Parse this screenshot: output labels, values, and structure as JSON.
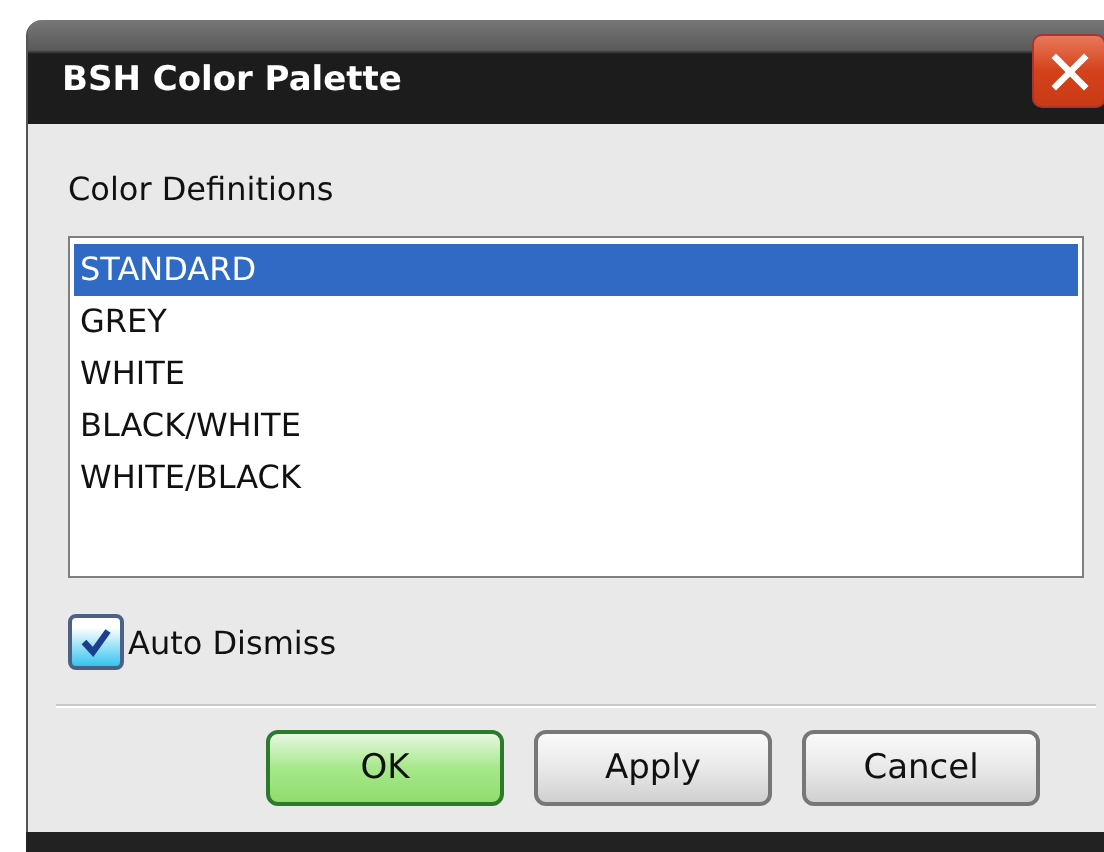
{
  "window": {
    "title": "BSH Color Palette"
  },
  "list_label": "Color Definitions",
  "color_definitions": [
    {
      "label": "STANDARD",
      "selected": true
    },
    {
      "label": "GREY",
      "selected": false
    },
    {
      "label": "WHITE",
      "selected": false
    },
    {
      "label": "BLACK/WHITE",
      "selected": false
    },
    {
      "label": "WHITE/BLACK",
      "selected": false
    }
  ],
  "auto_dismiss": {
    "label": "Auto Dismiss",
    "checked": true
  },
  "buttons": [
    {
      "label": "OK",
      "kind": "default"
    },
    {
      "label": "Apply",
      "kind": "normal"
    },
    {
      "label": "Cancel",
      "kind": "normal"
    }
  ]
}
